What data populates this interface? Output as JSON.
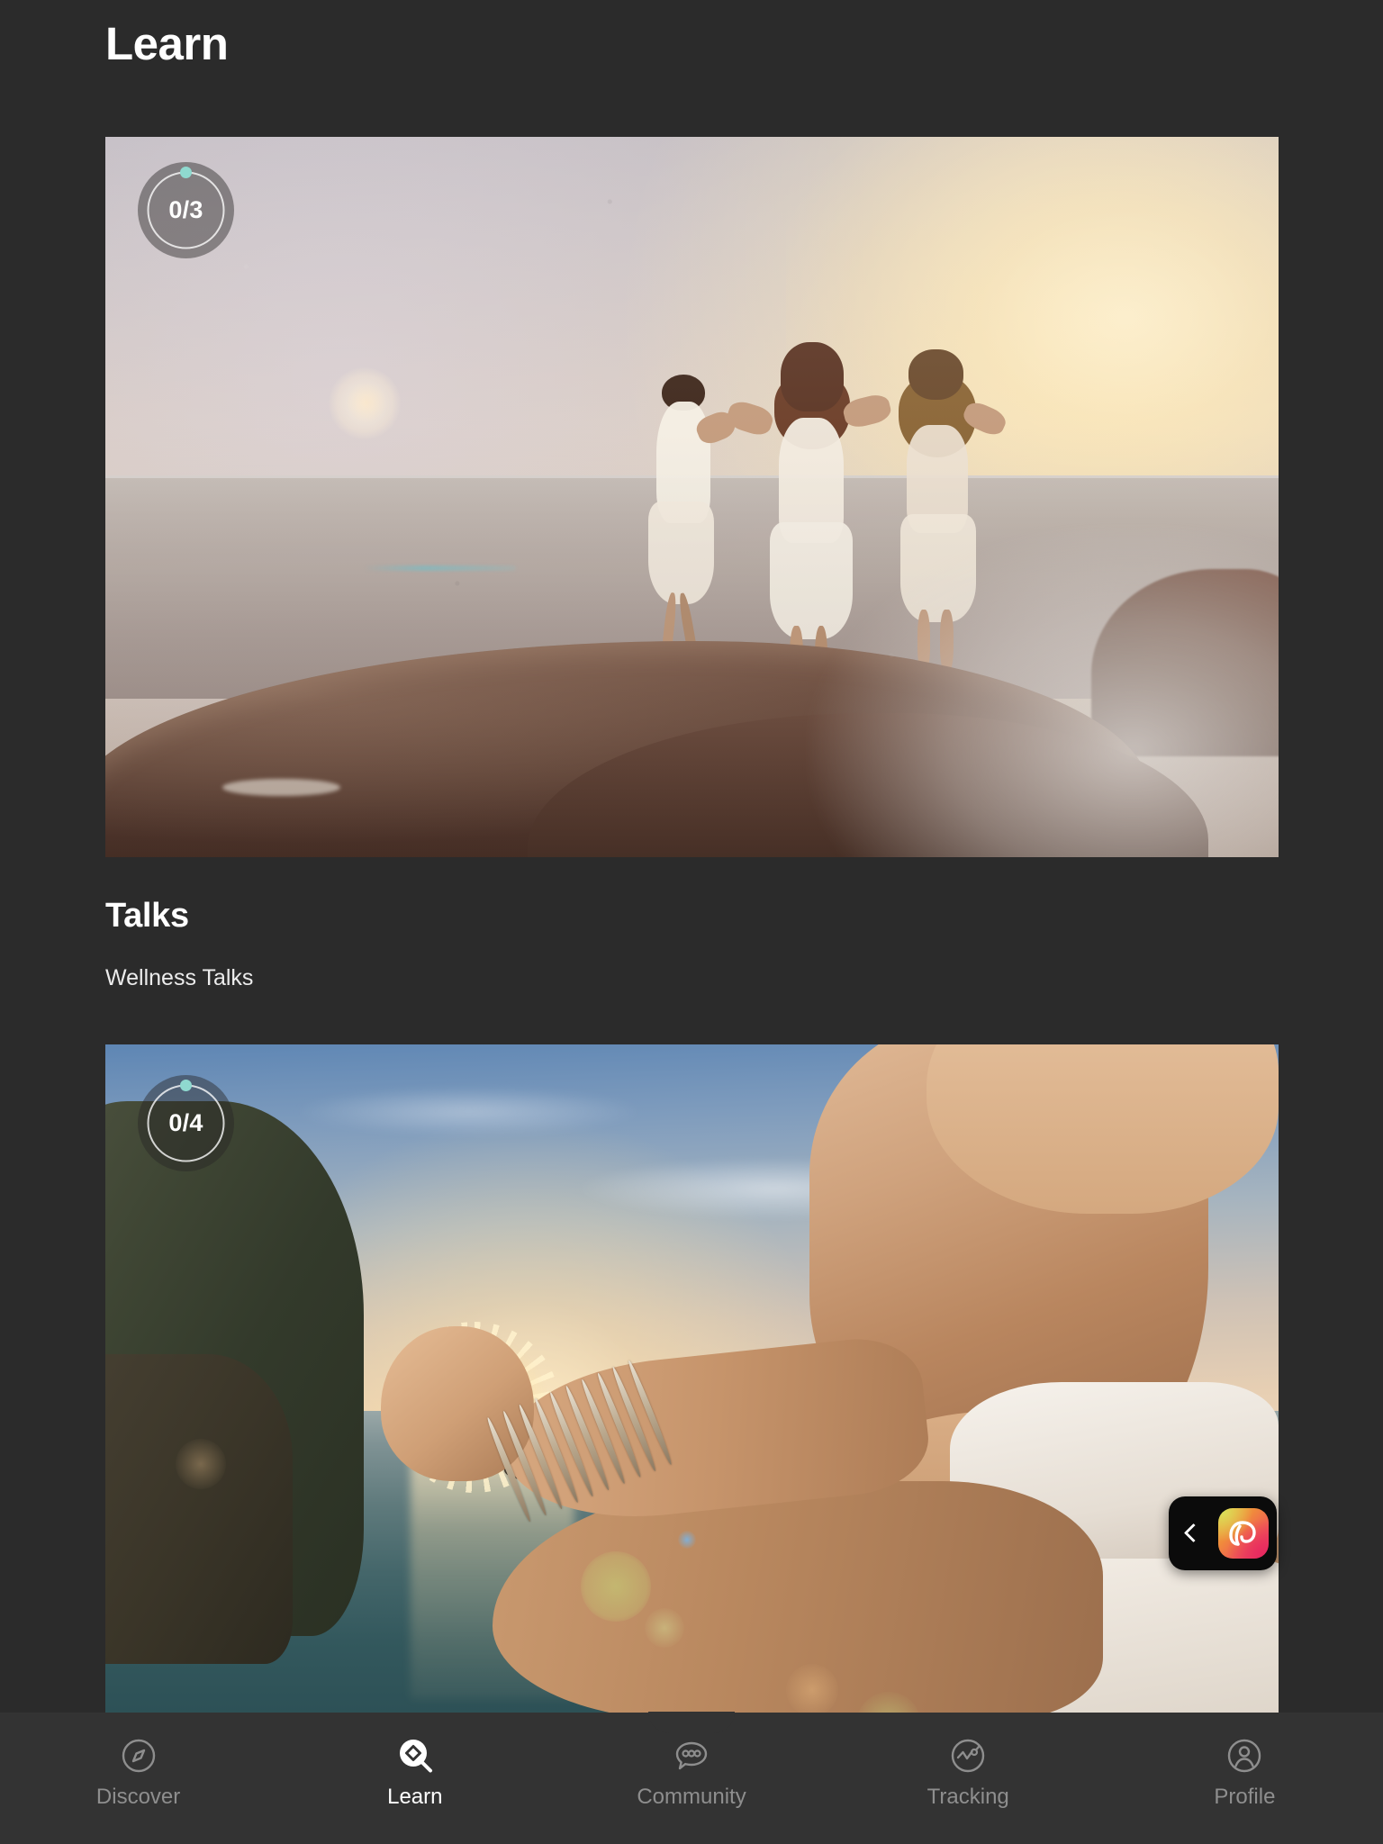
{
  "header": {
    "title": "Learn"
  },
  "theme": {
    "background": "#2b2b2b",
    "nav_background": "#333333",
    "accent_dot": "#8fd9cf",
    "text_primary": "#ffffff",
    "text_muted": "#8e8e8e"
  },
  "cards": [
    {
      "id": "card-1",
      "progress_label": "0/3",
      "progress_completed": 0,
      "progress_total": 3,
      "image_alt": "three women dancing on a rock at hazy sunrise"
    },
    {
      "id": "card-2",
      "progress_label": "0/4",
      "progress_completed": 0,
      "progress_total": 4,
      "image_alt": "person meditating holding the sun between fingers at sunset over the sea"
    }
  ],
  "section": {
    "title": "Talks",
    "subtitle": "Wellness Talks"
  },
  "pip": {
    "back_icon": "chevron-left-icon",
    "app_icon": "pinterest-app-icon"
  },
  "nav": {
    "items": [
      {
        "label": "Discover",
        "icon": "compass-icon",
        "active": false
      },
      {
        "label": "Learn",
        "icon": "magnifier-diamond-icon",
        "active": true
      },
      {
        "label": "Community",
        "icon": "chat-bubble-icon",
        "active": false
      },
      {
        "label": "Tracking",
        "icon": "chart-circle-icon",
        "active": false
      },
      {
        "label": "Profile",
        "icon": "user-circle-icon",
        "active": false
      }
    ]
  }
}
